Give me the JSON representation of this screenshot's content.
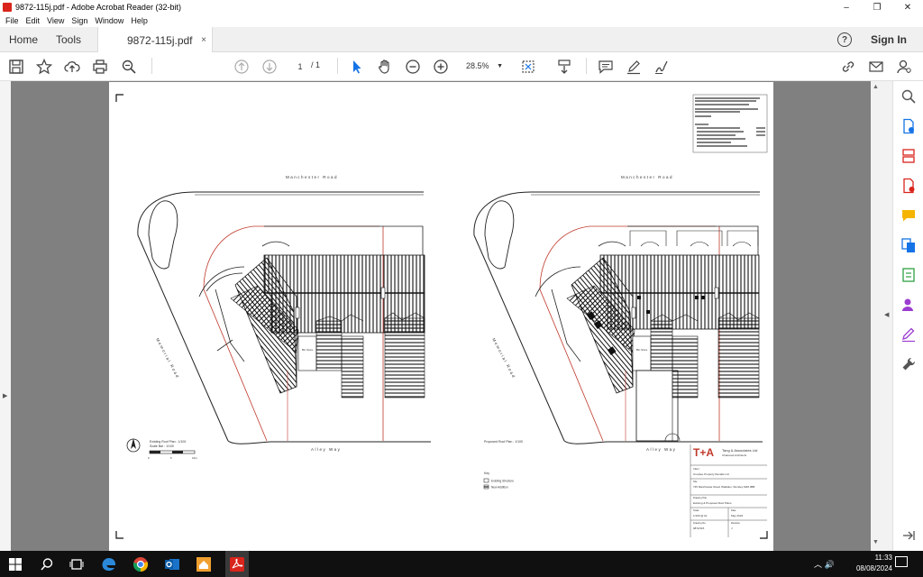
{
  "window": {
    "title": "9872-115j.pdf - Adobe Acrobat Reader (32-bit)",
    "controls": [
      "–",
      "❐",
      "✕"
    ]
  },
  "menu": [
    "File",
    "Edit",
    "View",
    "Sign",
    "Window",
    "Help"
  ],
  "tabs": {
    "home": "Home",
    "tools": "Tools",
    "document": "9872-115j.pdf",
    "close": "×"
  },
  "header": {
    "help": "?",
    "sign_in": "Sign In"
  },
  "toolbar": {
    "page_current": "1",
    "page_total": "/ 1",
    "zoom": "28.5%",
    "zoom_arrow": "▼"
  },
  "drawing": {
    "street_top_left": "Manchester Road",
    "street_top_right": "Manchester Road",
    "street_side_left": "Memorial Road",
    "street_side_right": "Memorial Road",
    "alley_left": "Alley Way",
    "alley_right": "Alley Way",
    "caption_left": "Existing Roof Plan : 1/100",
    "scale_left": "Scale Bar : 1/100",
    "scale_ticks": [
      "0",
      "5",
      "10m"
    ],
    "caption_right": "Proposed Roof Plan : 1/100",
    "key_title": "Key",
    "key_items": [
      "Existing Structure",
      "New Addition"
    ],
    "logo": "T+A",
    "firm_name": "Tang & Associates Ltd",
    "firm_sub": "Chartered Architects",
    "client_label": "Client",
    "client": "Croxdee Property Rentals Ltd",
    "site_label": "Site",
    "site": "745 Manchester Road, Walkden, Worsley M28 3BB",
    "drawing_label": "Drawing Title",
    "drawing_title": "Existing & Proposed Roof Plans",
    "scale_label": "Scale",
    "scale_value": "1/100 @ A1",
    "date_label": "Date",
    "date_value": "May 2024",
    "number_label": "Drawing No.",
    "number_value": "9872/115",
    "rev_label": "Revision",
    "rev_value": "J"
  },
  "taskbar": {
    "time": "11:33",
    "date": "08/08/2024"
  },
  "colors": {
    "accent_red": "#d9241c",
    "page_grey": "#808080",
    "taskbar": "#101010",
    "tool_blue": "#1473e6"
  }
}
